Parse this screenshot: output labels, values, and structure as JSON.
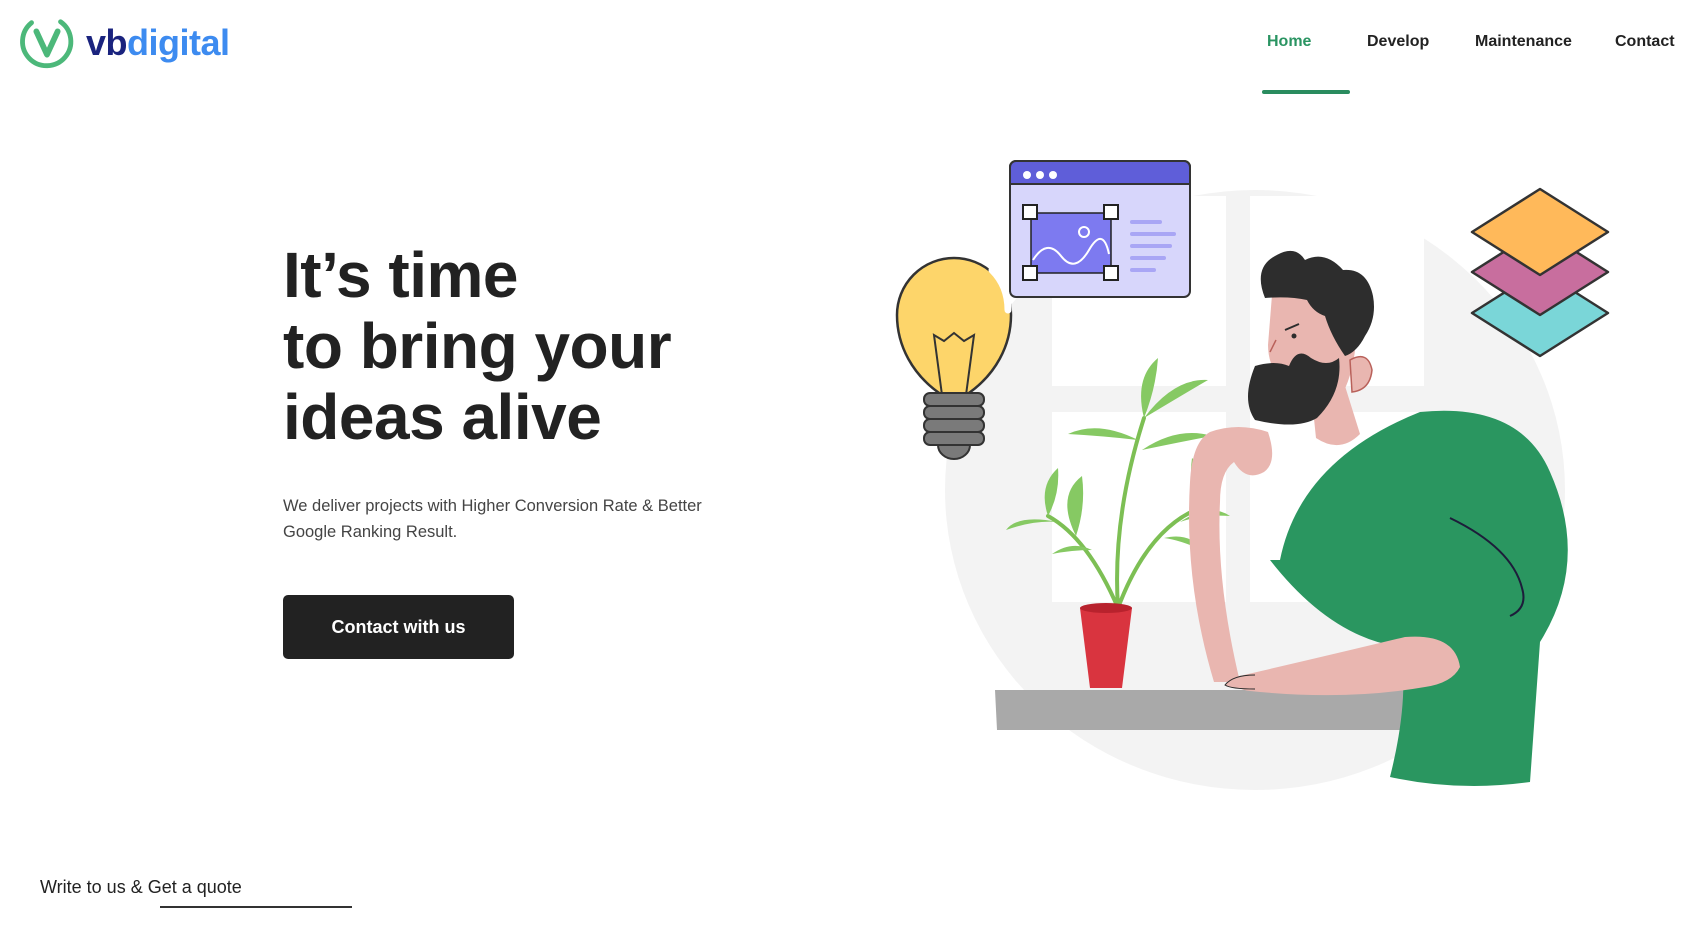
{
  "brand": {
    "name_part1": "vb",
    "name_part2": "digital",
    "colors": {
      "navy": "#1a237e",
      "blue": "#3d8bf0",
      "green": "#4cb87a"
    }
  },
  "nav": {
    "items": [
      {
        "label": "Home",
        "active": true
      },
      {
        "label": "Develop",
        "active": false
      },
      {
        "label": "Maintenance",
        "active": false
      },
      {
        "label": "Contact",
        "active": false
      }
    ],
    "active_color": "#2a9462"
  },
  "hero": {
    "title_line1": "It’s time",
    "title_line2": "to bring your",
    "title_line3_prefix": "ideas ",
    "title_line3_highlight": "alive",
    "subtitle": "We deliver projects with Higher Conversion Rate & Better Google Ranking Result.",
    "cta_label": "Contact with us",
    "highlight_color": "#3ecb35"
  },
  "footer": {
    "quote_text": "Write to us & Get a quote"
  },
  "illustration": {
    "icons": [
      "image-editor-window-icon",
      "lightbulb-icon",
      "layers-icon",
      "plant-icon",
      "thinking-man-figure"
    ],
    "colors": {
      "shirt": "#2a9660",
      "pot": "#d9343f",
      "bulb": "#fdd56a",
      "window": "#5f5ed9"
    }
  }
}
